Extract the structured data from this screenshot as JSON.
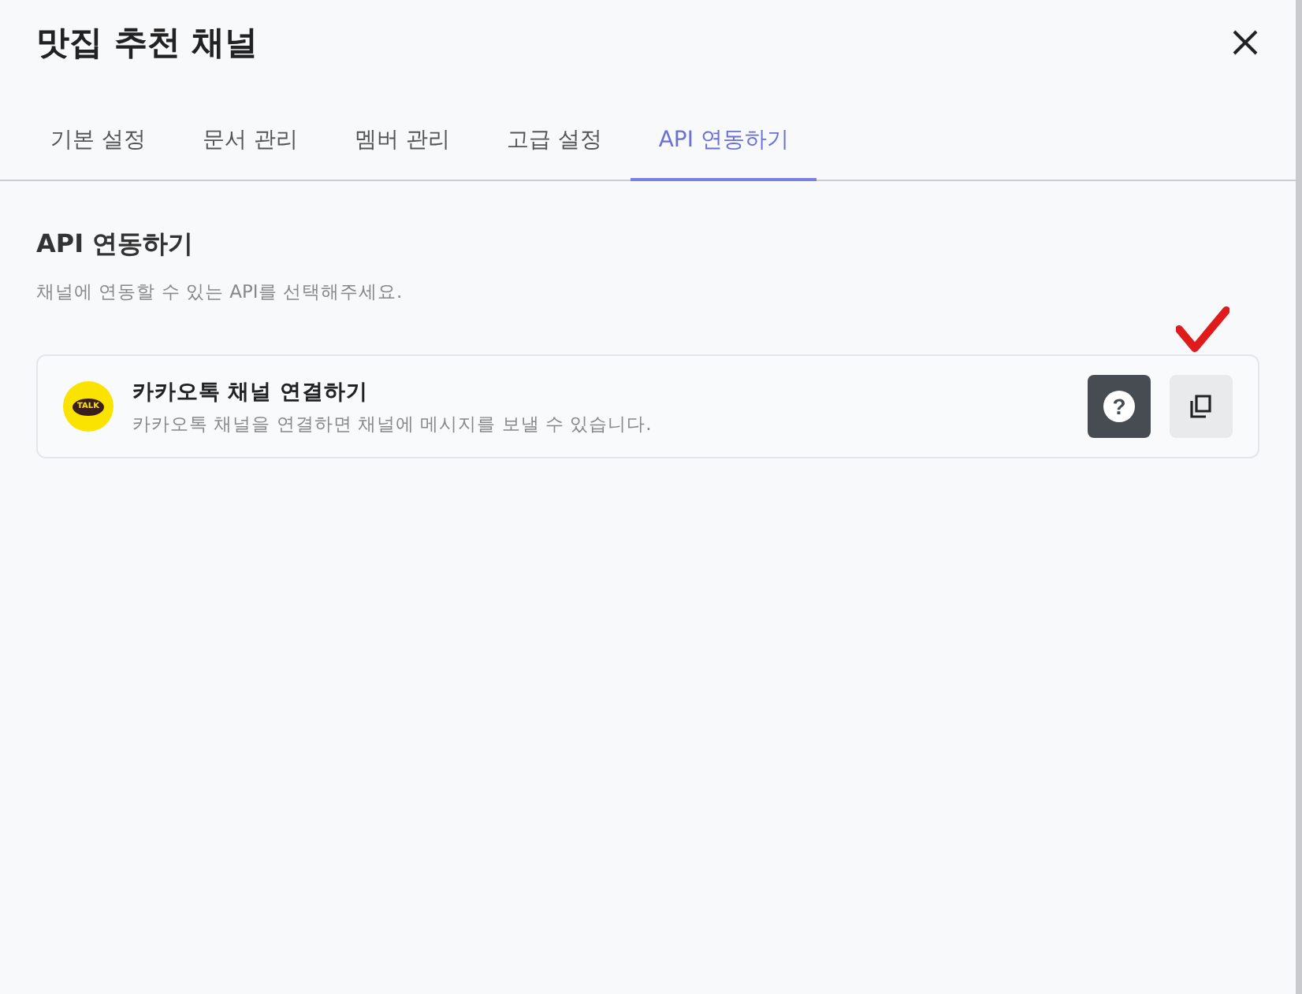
{
  "window": {
    "title": "맛집 추천 채널"
  },
  "tabs": [
    {
      "label": "기본 설정",
      "selected": false
    },
    {
      "label": "문서 관리",
      "selected": false
    },
    {
      "label": "멤버 관리",
      "selected": false
    },
    {
      "label": "고급 설정",
      "selected": false
    },
    {
      "label": "API 연동하기",
      "selected": true
    }
  ],
  "section": {
    "heading": "API 연동하기",
    "description": "채널에 연동할 수 있는 API를 선택해주세요."
  },
  "integrations": [
    {
      "logo_text": "TALK",
      "title": "카카오톡 채널 연결하기",
      "description": "카카오톡 채널을 연결하면 채널에 메시지를 보낼 수 있습니다.",
      "help_label": "?",
      "annotated": true
    }
  ]
}
